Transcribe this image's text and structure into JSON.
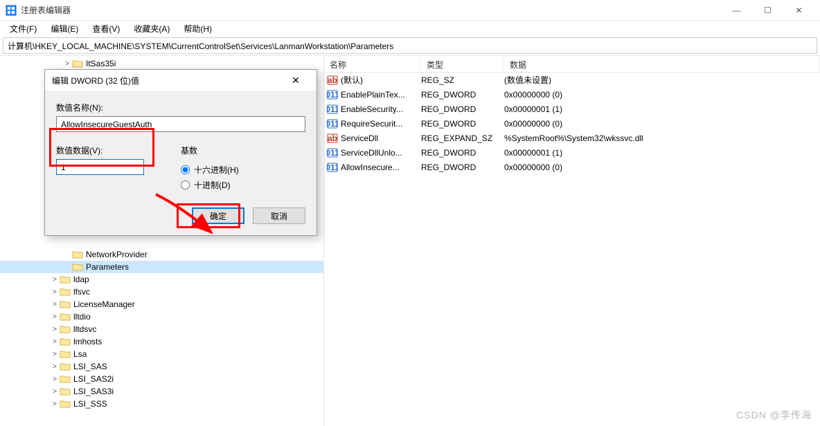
{
  "window": {
    "title": "注册表编辑器",
    "controls": {
      "min": "—",
      "max": "☐",
      "close": "✕"
    }
  },
  "menu": [
    "文件(F)",
    "编辑(E)",
    "查看(V)",
    "收藏夹(A)",
    "帮助(H)"
  ],
  "address": "计算机\\HKEY_LOCAL_MACHINE\\SYSTEM\\CurrentControlSet\\Services\\LanmanWorkstation\\Parameters",
  "tree": [
    {
      "indent": 5,
      "expand": ">",
      "label": "ItSas35i"
    },
    {
      "indent": 5,
      "expand": "",
      "label": "NetworkProvider"
    },
    {
      "indent": 5,
      "expand": "",
      "label": "Parameters",
      "selected": true
    },
    {
      "indent": 4,
      "expand": ">",
      "label": "ldap"
    },
    {
      "indent": 4,
      "expand": ">",
      "label": "lfsvc"
    },
    {
      "indent": 4,
      "expand": ">",
      "label": "LicenseManager"
    },
    {
      "indent": 4,
      "expand": ">",
      "label": "lltdio"
    },
    {
      "indent": 4,
      "expand": ">",
      "label": "lltdsvc"
    },
    {
      "indent": 4,
      "expand": ">",
      "label": "lmhosts"
    },
    {
      "indent": 4,
      "expand": ">",
      "label": "Lsa"
    },
    {
      "indent": 4,
      "expand": ">",
      "label": "LSI_SAS"
    },
    {
      "indent": 4,
      "expand": ">",
      "label": "LSI_SAS2i"
    },
    {
      "indent": 4,
      "expand": ">",
      "label": "LSI_SAS3i"
    },
    {
      "indent": 4,
      "expand": ">",
      "label": "LSI_SSS"
    }
  ],
  "list": {
    "headers": {
      "name": "名称",
      "type": "类型",
      "data": "数据"
    },
    "rows": [
      {
        "icon": "sz",
        "name": "(默认)",
        "type": "REG_SZ",
        "data": "(数值未设置)"
      },
      {
        "icon": "dw",
        "name": "EnablePlainTex...",
        "type": "REG_DWORD",
        "data": "0x00000000 (0)"
      },
      {
        "icon": "dw",
        "name": "EnableSecurity...",
        "type": "REG_DWORD",
        "data": "0x00000001 (1)"
      },
      {
        "icon": "dw",
        "name": "RequireSecurit...",
        "type": "REG_DWORD",
        "data": "0x00000000 (0)"
      },
      {
        "icon": "sz",
        "name": "ServiceDll",
        "type": "REG_EXPAND_SZ",
        "data": "%SystemRoot%\\System32\\wkssvc.dll"
      },
      {
        "icon": "dw",
        "name": "ServiceDllUnlo...",
        "type": "REG_DWORD",
        "data": "0x00000001 (1)"
      },
      {
        "icon": "dw",
        "name": "AllowInsecure...",
        "type": "REG_DWORD",
        "data": "0x00000000 (0)"
      }
    ]
  },
  "dialog": {
    "title": "编辑 DWORD (32 位)值",
    "name_label": "数值名称(N):",
    "name_value": "AllowInsecureGuestAuth",
    "data_label": "数值数据(V):",
    "data_value": "1",
    "radix_label": "基数",
    "radix_hex": "十六进制(H)",
    "radix_dec": "十进制(D)",
    "ok": "确定",
    "cancel": "取消"
  },
  "watermark": "CSDN @李传海"
}
